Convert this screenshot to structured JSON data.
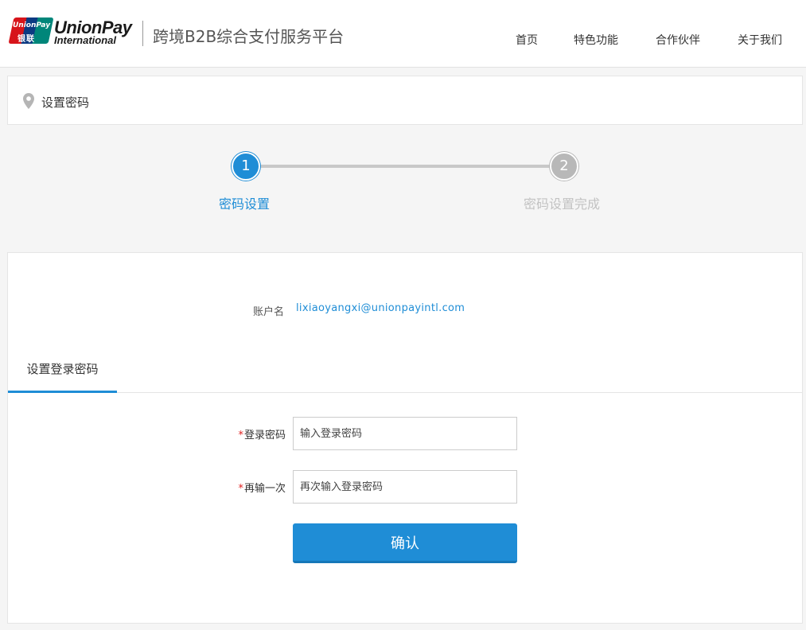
{
  "header": {
    "logo_line1": "UnionPay",
    "logo_line2": "International",
    "logo_mark_top": "UnionPay",
    "logo_mark_bottom": "银联",
    "platform_title": "跨境B2B综合支付服务平台",
    "nav": [
      {
        "label": "首页"
      },
      {
        "label": "特色功能"
      },
      {
        "label": "合作伙伴"
      },
      {
        "label": "关于我们"
      }
    ]
  },
  "breadcrumb": {
    "icon": "map-pin-icon",
    "text": "设置密码"
  },
  "steps": [
    {
      "number": "1",
      "label": "密码设置",
      "state": "active"
    },
    {
      "number": "2",
      "label": "密码设置完成",
      "state": "inactive"
    }
  ],
  "account": {
    "label": "账户名",
    "value": "lixiaoyangxi@unionpayintl.com"
  },
  "tab": {
    "label": "设置登录密码"
  },
  "form": {
    "password": {
      "label": "登录密码",
      "placeholder": "输入登录密码"
    },
    "confirm_password": {
      "label": "再输一次",
      "placeholder": "再次输入登录密码"
    },
    "required_mark": "*",
    "submit_label": "确认"
  },
  "colors": {
    "accent": "#1f8dd6",
    "inactive_step": "#b8b8b8",
    "required": "#e02020"
  }
}
